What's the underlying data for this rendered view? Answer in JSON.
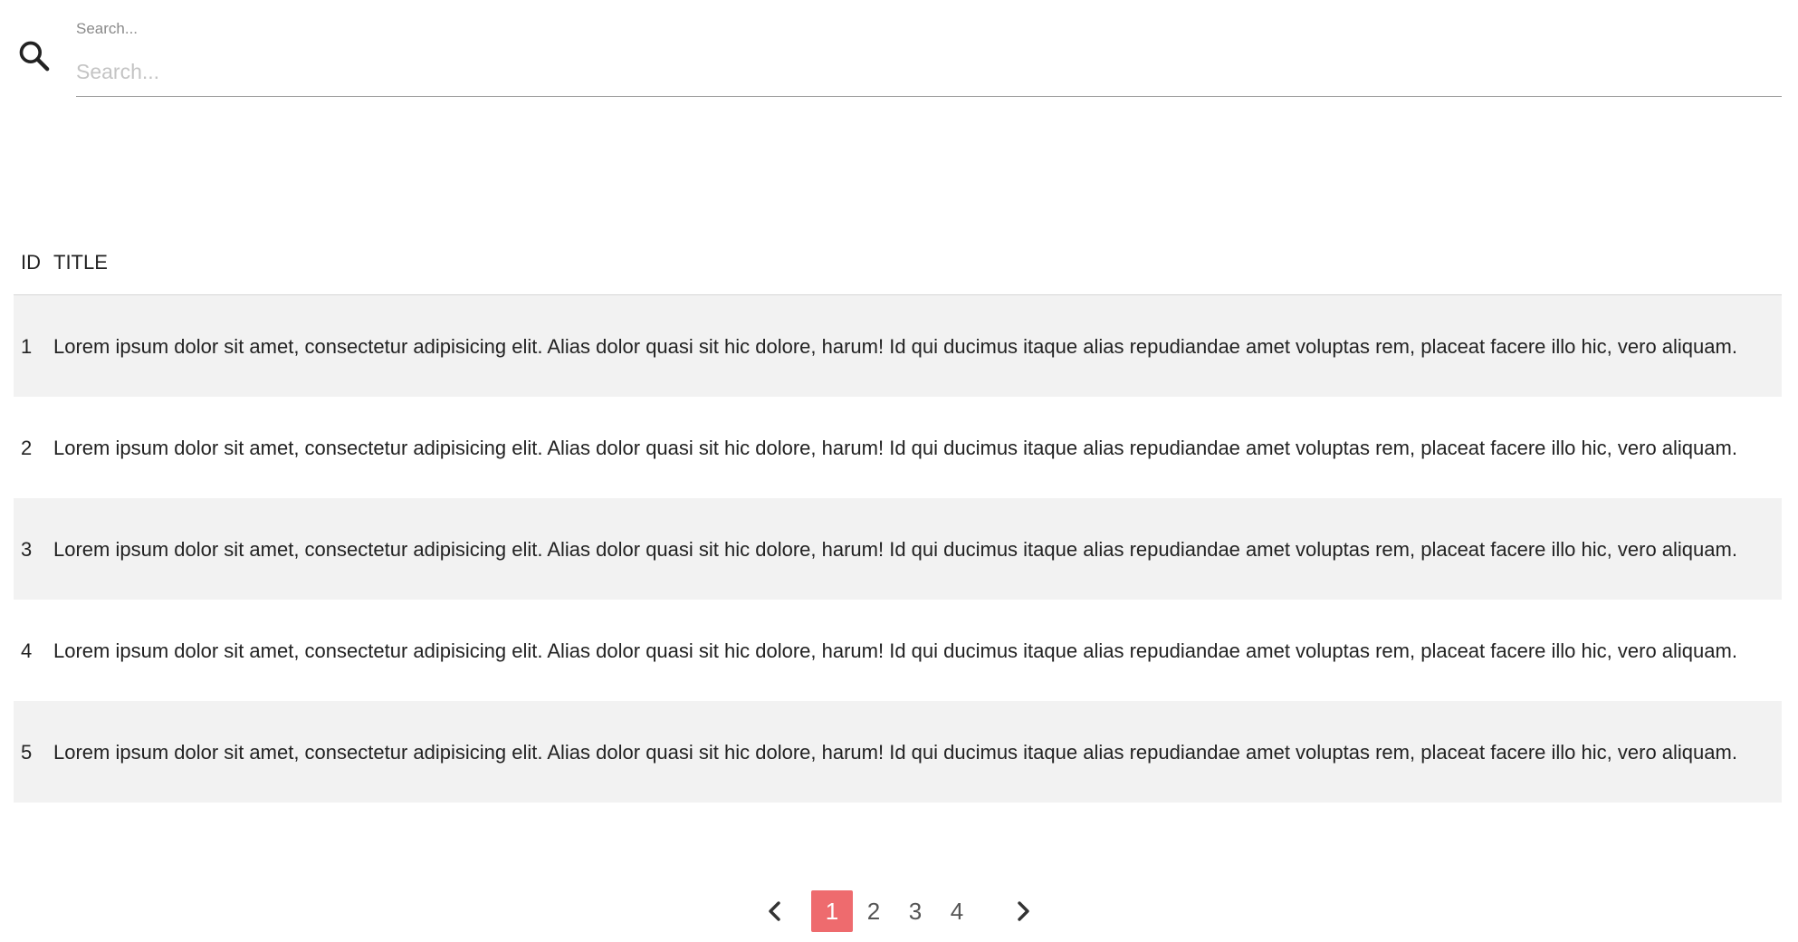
{
  "search": {
    "label": "Search...",
    "placeholder": "Search...",
    "value": ""
  },
  "table": {
    "columns": [
      "ID",
      "TITLE"
    ],
    "rows": [
      {
        "id": "1",
        "title": "Lorem ipsum dolor sit amet, consectetur adipisicing elit. Alias dolor quasi sit hic dolore, harum! Id qui ducimus itaque alias repudiandae amet voluptas rem, placeat facere illo hic, vero aliquam."
      },
      {
        "id": "2",
        "title": "Lorem ipsum dolor sit amet, consectetur adipisicing elit. Alias dolor quasi sit hic dolore, harum! Id qui ducimus itaque alias repudiandae amet voluptas rem, placeat facere illo hic, vero aliquam."
      },
      {
        "id": "3",
        "title": "Lorem ipsum dolor sit amet, consectetur adipisicing elit. Alias dolor quasi sit hic dolore, harum! Id qui ducimus itaque alias repudiandae amet voluptas rem, placeat facere illo hic, vero aliquam."
      },
      {
        "id": "4",
        "title": "Lorem ipsum dolor sit amet, consectetur adipisicing elit. Alias dolor quasi sit hic dolore, harum! Id qui ducimus itaque alias repudiandae amet voluptas rem, placeat facere illo hic, vero aliquam."
      },
      {
        "id": "5",
        "title": "Lorem ipsum dolor sit amet, consectetur adipisicing elit. Alias dolor quasi sit hic dolore, harum! Id qui ducimus itaque alias repudiandae amet voluptas rem, placeat facere illo hic, vero aliquam."
      }
    ]
  },
  "pagination": {
    "prev_icon": "chevron-left-icon",
    "next_icon": "chevron-right-icon",
    "pages": [
      "1",
      "2",
      "3",
      "4"
    ],
    "current": "1"
  },
  "colors": {
    "accent": "#ee6b6e",
    "row_shade": "#f2f2f2"
  }
}
